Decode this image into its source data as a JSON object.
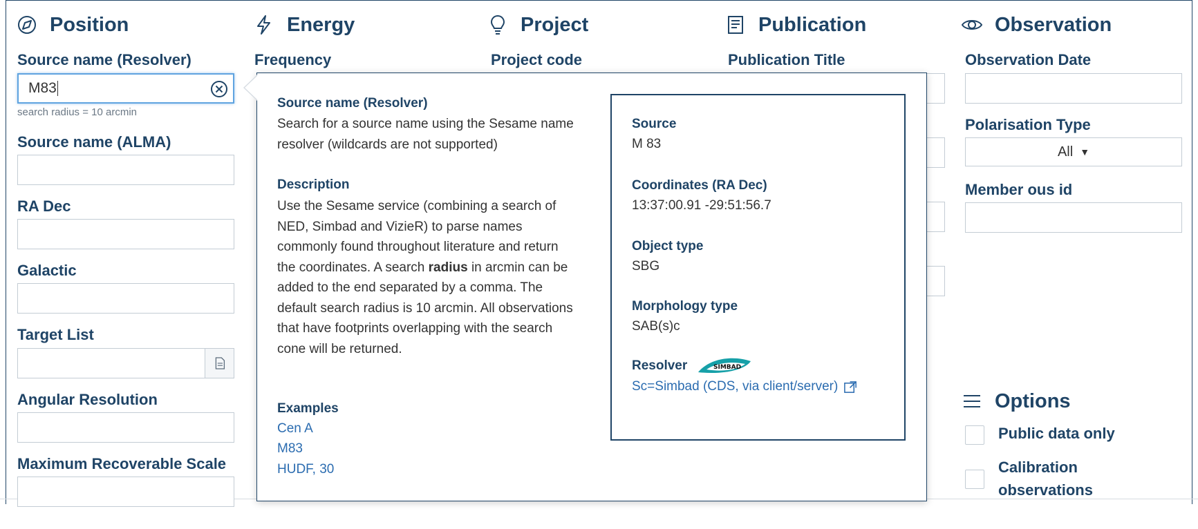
{
  "columns": {
    "position": {
      "title": "Position",
      "icon": "compass-icon"
    },
    "energy": {
      "title": "Energy",
      "icon": "lightning-icon"
    },
    "project": {
      "title": "Project",
      "icon": "lightbulb-icon"
    },
    "publication": {
      "title": "Publication",
      "icon": "document-icon"
    },
    "observation": {
      "title": "Observation",
      "icon": "eye-icon"
    }
  },
  "position_fields": {
    "source_resolver_label": "Source name (Resolver)",
    "source_resolver_value": "M83",
    "search_radius_hint": "search radius = 10 arcmin",
    "source_alma_label": "Source name (ALMA)",
    "ra_dec_label": "RA Dec",
    "galactic_label": "Galactic",
    "target_list_label": "Target List",
    "angular_resolution_label": "Angular Resolution",
    "max_recoverable_scale_label": "Maximum Recoverable Scale"
  },
  "energy_fields": {
    "frequency_label": "Frequency"
  },
  "project_fields": {
    "project_code_label": "Project code"
  },
  "publication_fields": {
    "publication_title_label": "Publication Title"
  },
  "observation_fields": {
    "observation_date_label": "Observation Date",
    "polarisation_type_label": "Polarisation Type",
    "polarisation_type_value": "All",
    "member_ous_id_label": "Member ous id"
  },
  "options": {
    "title": "Options",
    "icon": "menu-icon",
    "public_data_only": "Public data only",
    "calibration_line1": "Calibration",
    "calibration_line2": "observations"
  },
  "popover": {
    "help_title": "Source name (Resolver)",
    "help_text": "Search for a source name using the Sesame name resolver (wildcards are not supported)",
    "description_title": "Description",
    "description_before_bold": "Use the Sesame service (combining a search of NED, Simbad and VizieR) to parse names commonly found throughout literature and return the coordinates. A search ",
    "description_bold": "radius",
    "description_after_bold": " in arcmin can be added to the end separated by a comma. The default search radius is 10 arcmin. All observations that have footprints overlapping with the search cone will be returned.",
    "examples_title": "Examples",
    "examples": [
      "Cen A",
      "M83",
      "HUDF, 30"
    ],
    "result": {
      "source_label": "Source",
      "source_value": "M 83",
      "coords_label": "Coordinates (RA Dec)",
      "coords_value": "13:37:00.91 -29:51:56.7",
      "object_type_label": "Object type",
      "object_type_value": "SBG",
      "morphology_label": "Morphology type",
      "morphology_value": "SAB(s)c",
      "resolver_label": "Resolver",
      "resolver_logo_text": "SIMBAD",
      "resolver_link": "Sc=Simbad (CDS, via client/server)"
    }
  }
}
